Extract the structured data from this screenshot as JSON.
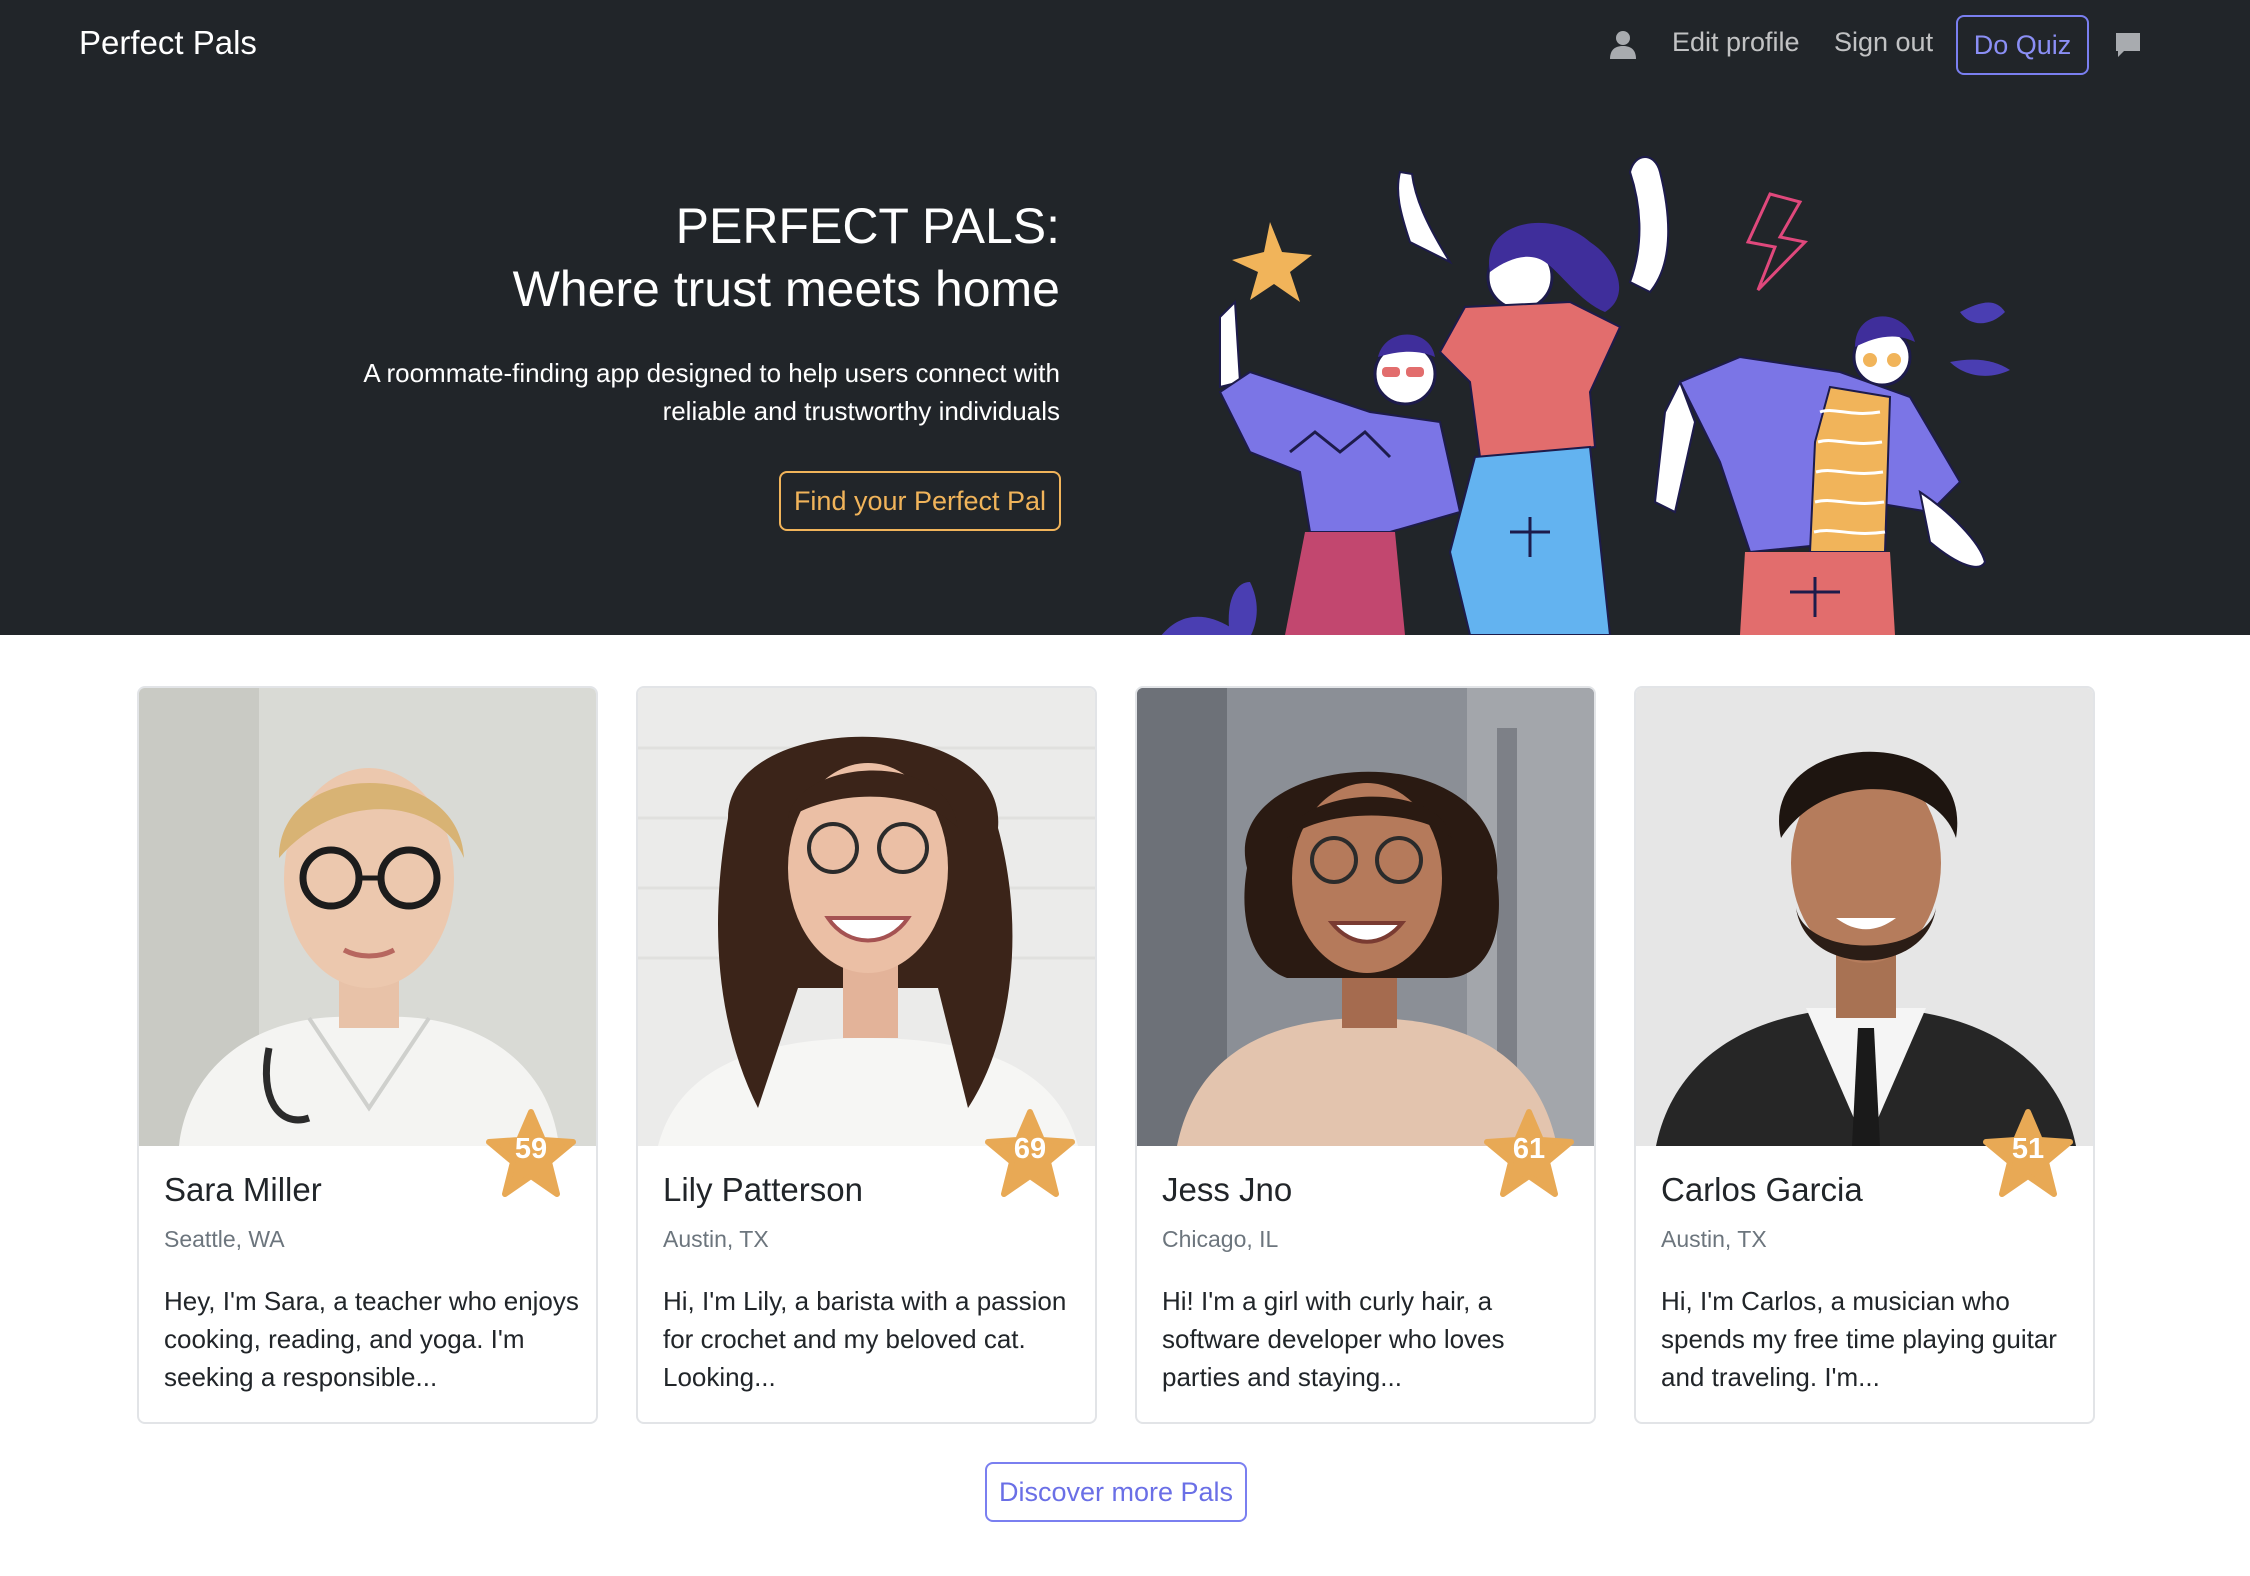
{
  "navbar": {
    "brand": "Perfect Pals",
    "user_icon": "person-icon",
    "edit_profile": "Edit profile",
    "sign_out": "Sign out",
    "do_quiz": "Do Quiz",
    "chat_icon": "chat-bubble-icon"
  },
  "hero": {
    "title_line1": "PERFECT PALS:",
    "title_line2": "Where trust meets home",
    "subtitle": "A roommate-finding app designed to help users connect with reliable and trustworthy individuals",
    "cta": "Find your Perfect Pal",
    "illustration": "three-dancing-friends-illustration"
  },
  "profiles": [
    {
      "name": "Sara Miller",
      "location": "Seattle, WA",
      "score": "59",
      "bio": "Hey, I'm Sara, a teacher who enjoys cooking, reading, and yoga. I'm seeking a responsible..."
    },
    {
      "name": "Lily Patterson",
      "location": "Austin, TX",
      "score": "69",
      "bio": "Hi, I'm Lily, a barista with a passion for crochet and my beloved cat. Looking..."
    },
    {
      "name": "Jess Jno",
      "location": "Chicago, IL",
      "score": "61",
      "bio": "Hi! I'm a girl with curly hair, a software developer who loves parties and staying..."
    },
    {
      "name": "Carlos Garcia",
      "location": "Austin, TX",
      "score": "51",
      "bio": "Hi, I'm Carlos, a musician who spends my free time playing guitar and traveling. I'm..."
    }
  ],
  "discover_more": "Discover more Pals",
  "colors": {
    "dark_bg": "#212529",
    "accent_orange": "#f1b45a",
    "accent_purple": "#7a7ff0",
    "star": "#e8a955"
  }
}
